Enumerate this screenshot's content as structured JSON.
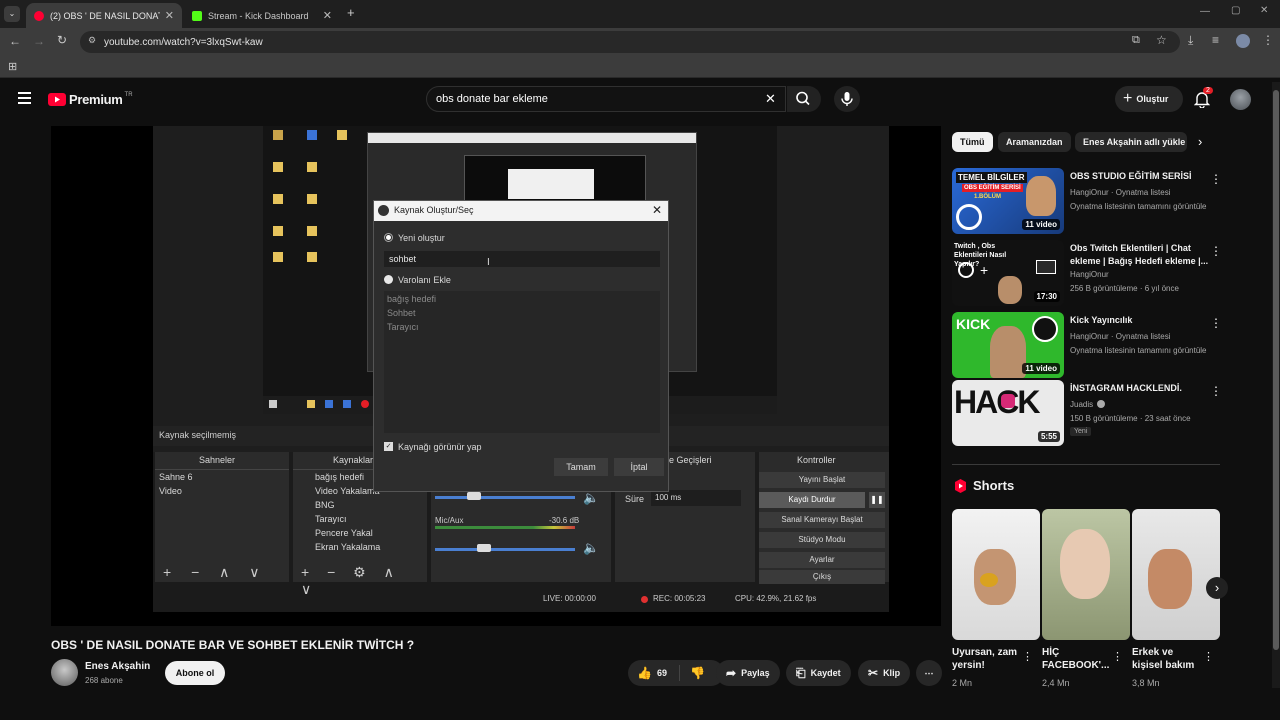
{
  "browser": {
    "tabs": [
      {
        "label": "(2) OBS ' DE NASIL DONATE BA",
        "active": true
      },
      {
        "label": "Stream - Kick Dashboard",
        "active": false
      }
    ],
    "url": "youtube.com/watch?v=3lxqSwt-kaw"
  },
  "masthead": {
    "logo_text": "Premium",
    "region": "TR",
    "search_value": "obs donate bar ekleme",
    "create_label": "Oluştur",
    "notification_count": "2"
  },
  "video": {
    "dialog_title": "Kaynak Oluştur/Seç",
    "radio_new": "Yeni oluştur",
    "new_name_value": "sohbet",
    "radio_existing": "Varolanı Ekle",
    "existing_items": [
      "bağış hedefi",
      "Sohbet",
      "Tarayıcı"
    ],
    "visible_checkbox": "Kaynağı görünür yap",
    "ok_label": "Tamam",
    "cancel_label": "İptal",
    "no_source_label": "Kaynak seçilmemiş",
    "scenes_header": "Sahneler",
    "scenes": [
      "Sahne 6",
      "Video"
    ],
    "sources_header": "Kaynaklar",
    "sources": [
      "bağış hedefi",
      "Video Yakalama",
      "BNG",
      "Tarayıcı",
      "Pencere Yakalama",
      "Ekran Yakalama"
    ],
    "transitions_header": "e Geçişleri",
    "duration_label": "Süre",
    "duration_value": "100 ms",
    "mic_label": "Mic/Aux",
    "mic_db": "-30.6 dB",
    "controls_header": "Kontroller",
    "controls": [
      "Yayını Başlat",
      "Kaydı Durdur",
      "Sanal Kamerayı Başlat",
      "Stüdyo Modu",
      "Ayarlar",
      "Çıkış"
    ],
    "status_live": "LIVE: 00:00:00",
    "status_rec": "REC: 00:05:23",
    "status_cpu": "CPU: 42.9%, 21.62 fps"
  },
  "watch": {
    "title": "OBS ' DE NASIL DONATE BAR VE SOHBET EKLENİR TWİTCH ?",
    "channel_name": "Enes Akşahin",
    "subscribers": "268 abone",
    "subscribe_label": "Abone ol",
    "likes": "69",
    "share_label": "Paylaş",
    "save_label": "Kaydet",
    "clip_label": "Klip"
  },
  "chips": [
    "Tümü",
    "Aramanızdan",
    "Enes Akşahin adlı yükle"
  ],
  "recommendations": [
    {
      "title": "OBS STUDIO EĞİTİM SERİSİ",
      "line1": "HangiOnur · Oynatma listesi",
      "line2": "Oynatma listesinin tamamını görüntüle",
      "badge": "11 video",
      "thumb_text1": "TEMEL BİLGİLER",
      "thumb_text2": "OBS EĞİTİM SERİSİ",
      "thumb_text3": "1.BÖLÜM"
    },
    {
      "title": "Obs Twitch Eklentileri | Chat ekleme | Bağış Hedefi ekleme |...",
      "line1": "HangiOnur",
      "line2": "256 B görüntüleme · 6 yıl önce",
      "badge": "17:30",
      "thumb_text1": "Twitch , Obs Eklentileri Nasıl Yapılır?"
    },
    {
      "title": "Kick Yayıncılık",
      "line1": "HangiOnur · Oynatma listesi",
      "line2": "Oynatma listesinin tamamını görüntüle",
      "badge": "11 video",
      "thumb_text1": "KICK"
    },
    {
      "title": "İNSTAGRAM HACKLENDİ.",
      "line1": "Juadis",
      "line2": "150 B görüntüleme · 23 saat önce",
      "new_label": "Yeni",
      "badge": "5:55",
      "thumb_text1": "HACK"
    }
  ],
  "shorts": {
    "header": "Shorts",
    "items": [
      {
        "title": "Uyursan, zam yersin!",
        "views": "2 Mn"
      },
      {
        "title": "HİÇ FACEBOOK'...",
        "views": "2,4 Mn"
      },
      {
        "title": "Erkek ve kişisel bakım",
        "views": "3,8 Mn"
      }
    ]
  },
  "colors": {
    "youtube_red": "#ff0033",
    "background": "#0f0f0f",
    "obs_panel": "#2b2b2b"
  }
}
